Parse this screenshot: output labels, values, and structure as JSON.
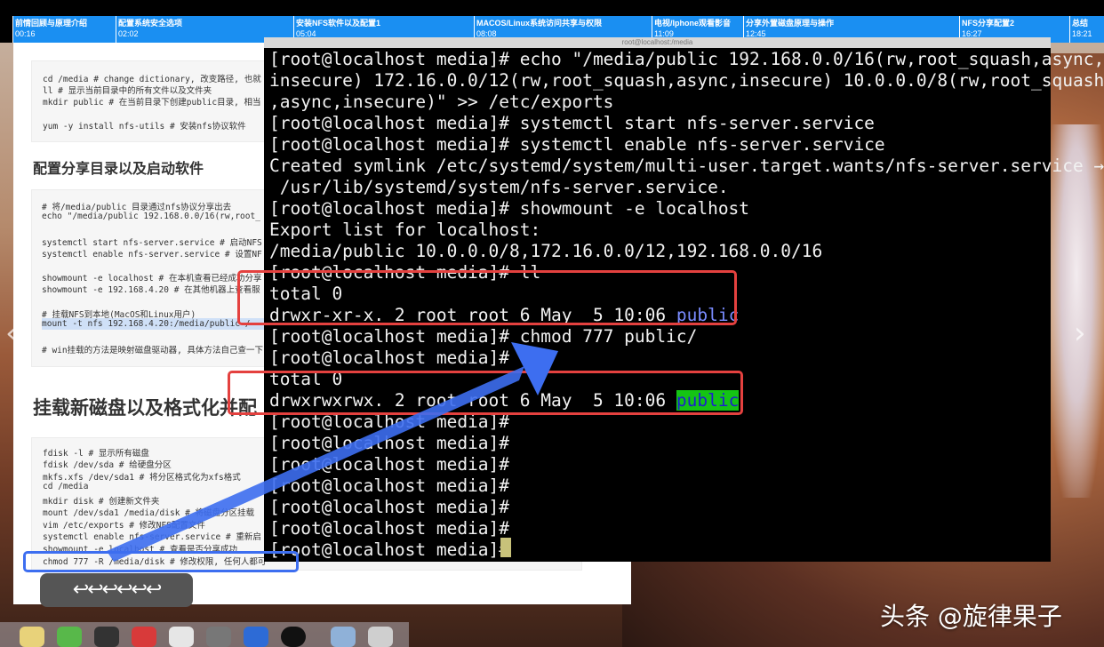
{
  "chapters": [
    {
      "title": "前情回顾与原理介绍",
      "time": "00:16"
    },
    {
      "title": "配置系统安全选项",
      "time": "02:02"
    },
    {
      "title": "安装NFS软件以及配置1",
      "time": "05:04"
    },
    {
      "title": "MACOS/Linux系统访问共享与权限",
      "time": "08:08"
    },
    {
      "title": "电视/Iphone观看影音",
      "time": "11:09"
    },
    {
      "title": "分享外置磁盘原理与操作",
      "time": "12:45"
    },
    {
      "title": "NFS分享配置2",
      "time": "16:27"
    },
    {
      "title": "总结",
      "time": "18:21"
    }
  ],
  "terminal_title": "root@localhost:/media",
  "terminal_lines": [
    "[root@localhost media]# echo \"/media/public 192.168.0.0/16(rw,root_squash,async,",
    "insecure) 172.16.0.0/12(rw,root_squash,async,insecure) 10.0.0.0/8(rw,root_squash",
    ",async,insecure)\" >> /etc/exports",
    "[root@localhost media]# systemctl start nfs-server.service",
    "[root@localhost media]# systemctl enable nfs-server.service",
    "Created symlink /etc/systemd/system/multi-user.target.wants/nfs-server.service →",
    " /usr/lib/systemd/system/nfs-server.service.",
    "[root@localhost media]# showmount -e localhost",
    "Export list for localhost:",
    "/media/public 10.0.0.0/8,172.16.0.0/12,192.168.0.0/16",
    "[root@localhost media]# ll",
    "total 0",
    "drwxr-xr-x. 2 root root 6 May  5 10:06 ",
    "[root@localhost media]# chmod 777 public/",
    "[root@localhost media]# ll",
    "total 0",
    "drwxrwxrwx. 2 root root 6 May  5 10:06 ",
    "[root@localhost media]#",
    "[root@localhost media]#",
    "[root@localhost media]#",
    "[root@localhost media]#",
    "[root@localhost media]#",
    "[root@localhost media]#",
    "[root@localhost media]# "
  ],
  "public_word": "public",
  "doc": {
    "block1": [
      "cd /media  # change dictionary, 改变路径, 也就",
      "ll # 显示当前目录中的所有文件以及文件夹",
      "mkdir public # 在当前目录下创建public目录, 相当",
      "",
      "yum -y install nfs-utils # 安装nfs协议软件"
    ],
    "heading1": "配置分享目录以及启动软件",
    "block2": [
      "# 将/media/public 目录通过nfs协议分享出去",
      "echo \"/media/public 192.168.0.0/16(rw,root_",
      "",
      "systemctl start nfs-server.service # 启动NFS",
      "systemctl enable nfs-server.service # 设置NF",
      "",
      "showmount -e localhost # 在本机查看已经成功分享",
      "showmount -e 192.168.4.20 # 在其他机器上查看服",
      "",
      "# 挂载NFS到本地(MacOS和Linux用户)",
      "mount -t nfs 192.168.4.20:/media/public /",
      "",
      "# win挂载的方法是映射磁盘驱动器, 具体方法自己查一下"
    ],
    "heading2": "挂载新磁盘以及格式化并配",
    "block3": [
      "fdisk -l # 显示所有磁盘",
      "fdisk /dev/sda  # 给硬盘分区",
      "mkfs.xfs /dev/sda1 # 将分区格式化为xfs格式",
      "cd /media",
      "mkdir disk # 创建新文件夹",
      "mount /dev/sda1 /media/disk  # 将磁盘分区挂载",
      "vim /etc/exports # 修改NFS配置文件",
      "systemctl enable nfs-server.service # 重新启",
      "showmount -e localhost # 查看是否分享成功",
      "chmod 777 -R /media/disk # 修改权限, 任何人都可"
    ]
  },
  "undo_arrows": "↩↩↩↩↩↩",
  "nav_prev": "‹",
  "nav_next": "›",
  "watermark": "头条 @旋律果子",
  "colors": {
    "chapter_bar": "#1a8ff2",
    "annotation_red": "#e4413f",
    "annotation_blue": "#3d6ef0",
    "public_dir": "#7a8cff"
  }
}
